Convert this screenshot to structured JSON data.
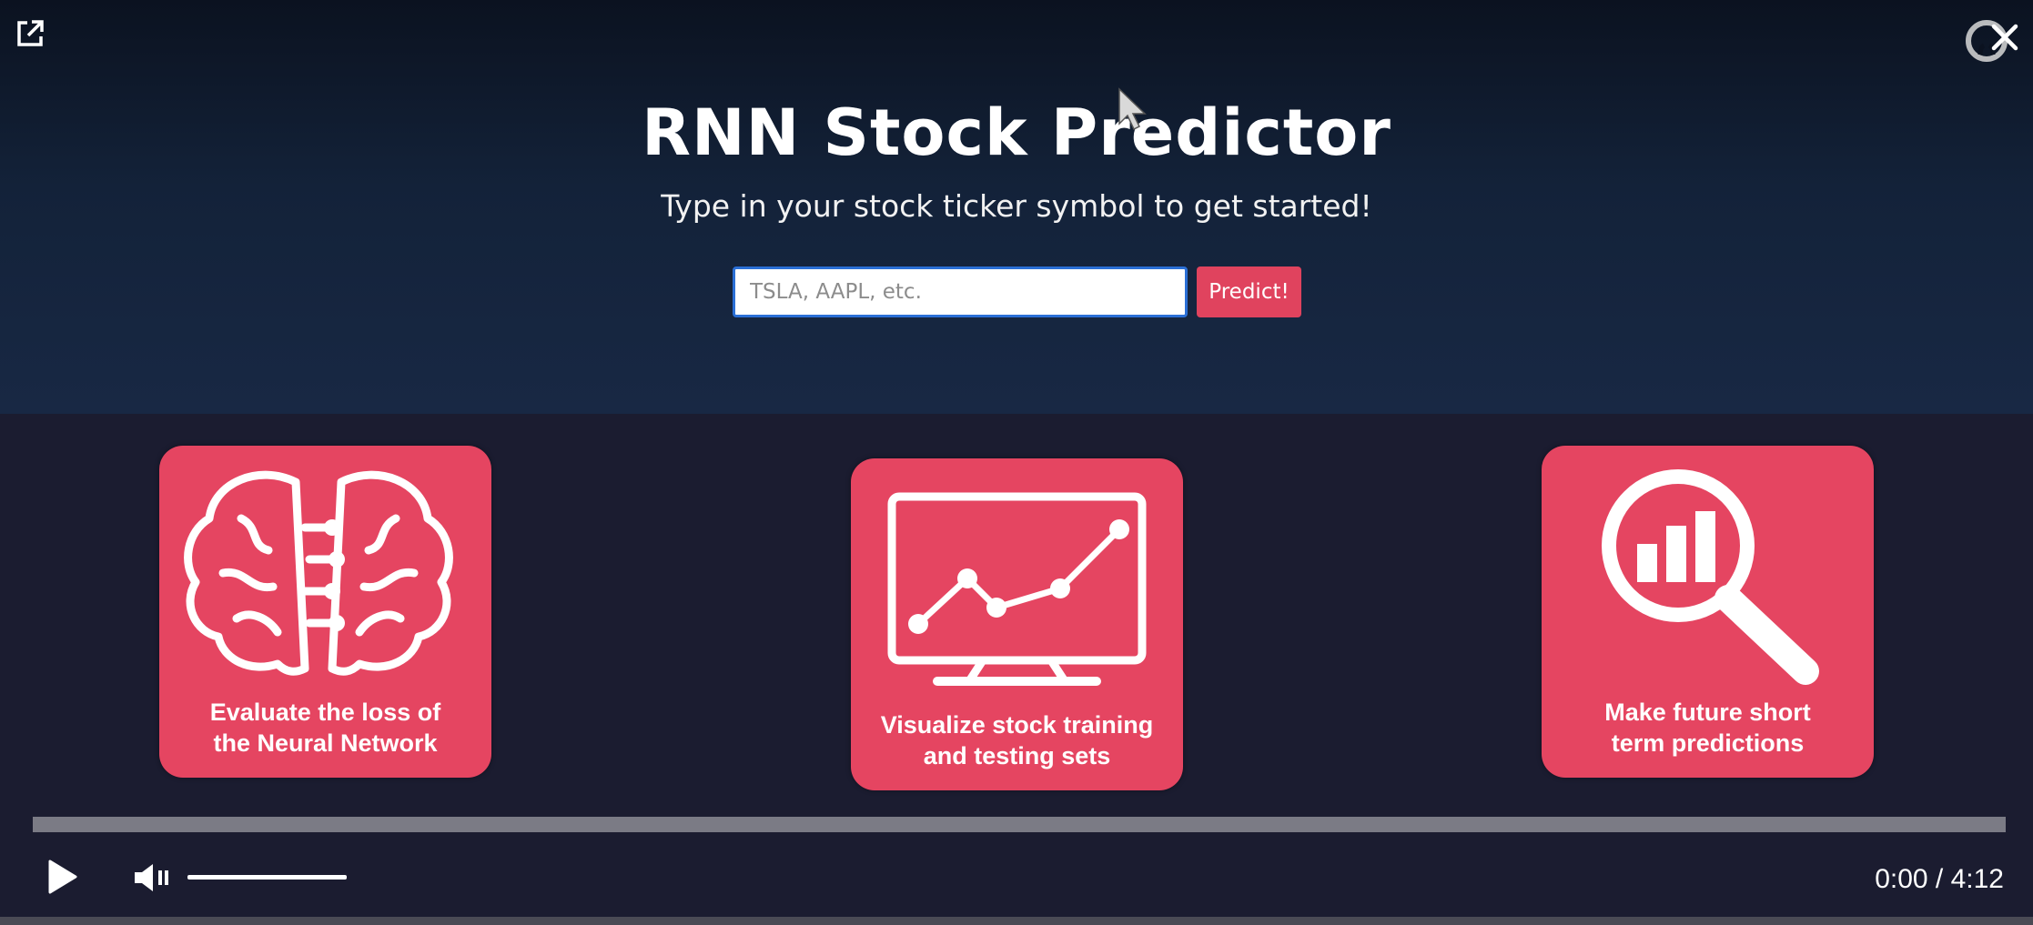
{
  "hero": {
    "title": "RNN Stock Predictor",
    "subtitle": "Type in your stock ticker symbol to get started!",
    "input_placeholder": "TSLA, AAPL, etc.",
    "input_value": "",
    "predict_label": "Predict!"
  },
  "cards": [
    {
      "icon": "brain-network-icon",
      "label": "Evaluate the loss of\nthe Neural Network"
    },
    {
      "icon": "monitor-line-chart-icon",
      "label": "Visualize stock training\nand testing sets"
    },
    {
      "icon": "magnifier-bar-chart-icon",
      "label": "Make future short\nterm predictions"
    }
  ],
  "player": {
    "time": "0:00 / 4:12",
    "progress": 0,
    "volume": 1.0,
    "muted": true
  },
  "colors": {
    "accent": "#e54561",
    "hero_bg": "#132239",
    "body_bg": "#1b1c30"
  }
}
